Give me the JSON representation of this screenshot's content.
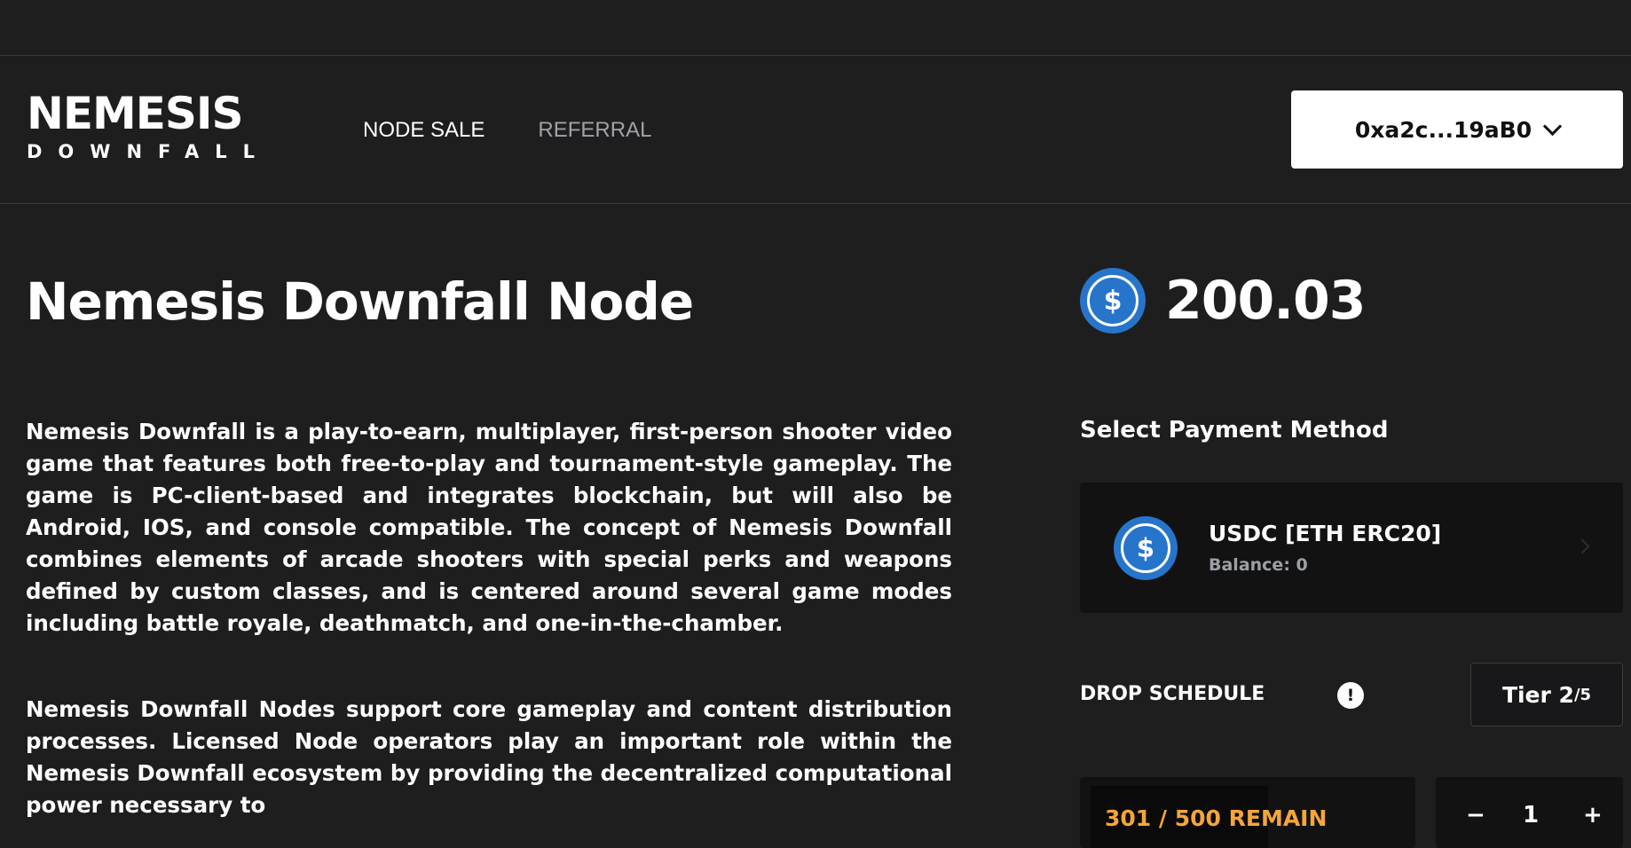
{
  "header": {
    "logo_top": "NEMESIS",
    "logo_bottom": "DOWNFALL",
    "nav": [
      {
        "label": "NODE SALE",
        "active": true
      },
      {
        "label": "REFERRAL",
        "active": false
      }
    ],
    "wallet": "0xa2c...19aB0"
  },
  "main": {
    "title": "Nemesis Downfall Node",
    "description_1": "Nemesis Downfall is a play-to-earn, multiplayer, first-person shooter video game that features both free-to-play and tournament-style gameplay. The game is PC-client-based and integrates blockchain, but will also be Android, IOS, and console compatible. The concept of Nemesis Downfall combines elements of arcade shooters with special perks and weapons defined by custom classes, and is centered around several game modes including battle royale, deathmatch, and one-in-the-chamber.",
    "description_2": "Nemesis Downfall Nodes support core gameplay and content distribution processes. Licensed Node operators play an important role within the Nemesis Downfall ecosystem by providing the decentralized computational power necessary to"
  },
  "purchase": {
    "price": "200.03",
    "payment_label": "Select Payment Method",
    "payment_method": {
      "name": "USDC [ETH ERC20]",
      "balance": "Balance: 0"
    },
    "drop_schedule_label": "DROP SCHEDULE",
    "info_symbol": "!",
    "tier_prefix": "Tier 2",
    "tier_total": "/5",
    "remaining": "301 / 500 REMAIN",
    "remaining_fraction": 0.602,
    "quantity": "1",
    "minus_symbol": "−",
    "plus_symbol": "+",
    "coin_symbol": "$"
  },
  "colors": {
    "background": "#1e1e1f",
    "card": "#121213",
    "usdc_blue": "#2775ca",
    "remain_orange": "#f5a53a",
    "nav_muted": "#9ea3a8"
  },
  "icons": [
    "usdc-coin-icon",
    "chevron-down-icon",
    "info-icon",
    "chevron-right-icon"
  ]
}
